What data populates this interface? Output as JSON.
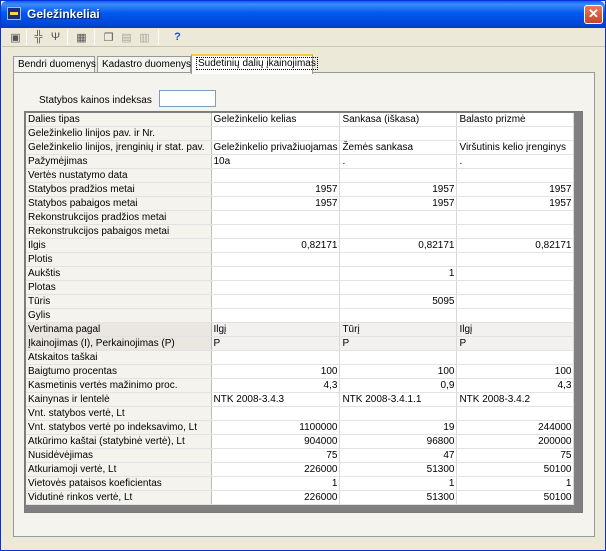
{
  "window": {
    "title": "Geležinkeliai",
    "close_glyph": "✕"
  },
  "toolbar": {
    "icons": [
      "save-icon",
      "tree-icon",
      "fork-icon",
      "calculator-icon",
      "copy-icon",
      "paste-icon",
      "clipboard-icon",
      "help-icon"
    ]
  },
  "tabs": [
    {
      "label": "Bendri duomenys",
      "active": false
    },
    {
      "label": "Kadastro duomenys",
      "active": false
    },
    {
      "label": "Sudetinių dalių įkainojimas",
      "active": true
    }
  ],
  "index_field": {
    "label": "Statybos kainos indeksas",
    "value": ""
  },
  "grid": {
    "rows": [
      {
        "label": "Dalies tipas",
        "values": [
          "Geležinkelio kelias",
          "Sankasa (iškasa)",
          "Balasto prizmė"
        ],
        "align": "left"
      },
      {
        "label": "Geležinkelio linijos pav. ir Nr.",
        "values": [
          "",
          "",
          ""
        ],
        "align": "left"
      },
      {
        "label": "Geležinkelio linijos, įrenginių ir stat. pav.",
        "values": [
          "Geležinkelio privažiuojamas",
          "Žemės sankasa",
          "Viršutinis kelio įrenginys"
        ],
        "align": "left"
      },
      {
        "label": "Pažymėjimas",
        "values": [
          "10a",
          ".",
          "."
        ],
        "align": "left"
      },
      {
        "label": "Vertės nustatymo data",
        "values": [
          "",
          "",
          ""
        ],
        "align": "left"
      },
      {
        "label": "Statybos pradžios metai",
        "values": [
          "1957",
          "1957",
          "1957"
        ],
        "align": "right"
      },
      {
        "label": "Statybos pabaigos metai",
        "values": [
          "1957",
          "1957",
          "1957"
        ],
        "align": "right"
      },
      {
        "label": "Rekonstrukcijos pradžios metai",
        "values": [
          "",
          "",
          ""
        ],
        "align": "right"
      },
      {
        "label": "Rekonstrukcijos pabaigos metai",
        "values": [
          "",
          "",
          ""
        ],
        "align": "right"
      },
      {
        "label": "Ilgis",
        "values": [
          "0,82171",
          "0,82171",
          "0,82171"
        ],
        "align": "right"
      },
      {
        "label": "Plotis",
        "values": [
          "",
          "",
          ""
        ],
        "align": "right"
      },
      {
        "label": "Aukštis",
        "values": [
          "",
          "1",
          ""
        ],
        "align": "right"
      },
      {
        "label": "Plotas",
        "values": [
          "",
          "",
          ""
        ],
        "align": "right"
      },
      {
        "label": "Tūris",
        "values": [
          "",
          "5095",
          ""
        ],
        "align": "right"
      },
      {
        "label": "Gylis",
        "values": [
          "",
          "",
          ""
        ],
        "align": "right"
      },
      {
        "label": "Vertinama pagal",
        "values": [
          "Ilgį",
          "Tūrį",
          "Ilgį"
        ],
        "align": "left",
        "highlight": true
      },
      {
        "label": "Įkainojimas (I), Perkainojimas (P)",
        "values": [
          "P",
          "P",
          "P"
        ],
        "align": "left",
        "highlight": true
      },
      {
        "label": "Atskaitos taškai",
        "values": [
          "",
          "",
          ""
        ],
        "align": "left"
      },
      {
        "label": "Baigtumo procentas",
        "values": [
          "100",
          "100",
          "100"
        ],
        "align": "right"
      },
      {
        "label": "Kasmetinis vertės mažinimo proc.",
        "values": [
          "4,3",
          "0,9",
          "4,3"
        ],
        "align": "right"
      },
      {
        "label": "Kainynas ir lentelė",
        "values": [
          "NTK 2008-3.4.3",
          "NTK 2008-3.4.1.1",
          "NTK 2008-3.4.2"
        ],
        "align": "left"
      },
      {
        "label": "Vnt. statybos vertė, Lt",
        "values": [
          "",
          "",
          ""
        ],
        "align": "right"
      },
      {
        "label": "Vnt. statybos vertė po indeksavimo, Lt",
        "values": [
          "1100000",
          "19",
          "244000"
        ],
        "align": "right"
      },
      {
        "label": "Atkūrimo kaštai (statybinė vertė), Lt",
        "values": [
          "904000",
          "96800",
          "200000"
        ],
        "align": "right"
      },
      {
        "label": "Nusidėvėjimas",
        "values": [
          "75",
          "47",
          "75"
        ],
        "align": "right"
      },
      {
        "label": "Atkuriamoji vertė, Lt",
        "values": [
          "226000",
          "51300",
          "50100"
        ],
        "align": "right"
      },
      {
        "label": "Vietovės pataisos koeficientas",
        "values": [
          "1",
          "1",
          "1"
        ],
        "align": "right"
      },
      {
        "label": "Vidutinė rinkos vertė, Lt",
        "values": [
          "226000",
          "51300",
          "50100"
        ],
        "align": "right"
      }
    ]
  }
}
